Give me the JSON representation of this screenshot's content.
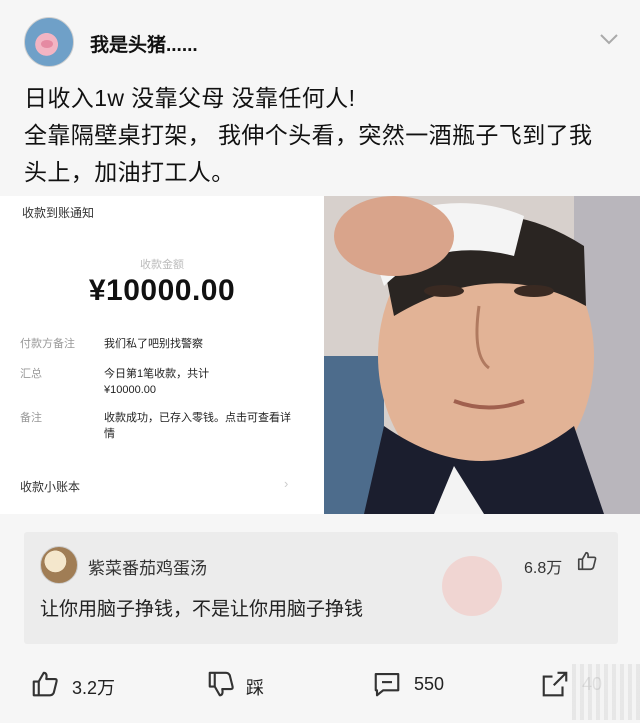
{
  "header": {
    "username": "我是头猪......"
  },
  "post": {
    "lines": [
      "日收入1w  没靠父母  没靠任何人!",
      "全靠隔壁桌打架，  我伸个头看，突然一酒瓶子飞到了我",
      "头上，加油打工人。"
    ]
  },
  "receipt": {
    "title": "收款到账通知",
    "amount_label": "收款金额",
    "amount": "¥10000.00",
    "rows": [
      {
        "key": "付款方备注",
        "value": "我们私了吧别找警察"
      },
      {
        "key": "汇总",
        "value": "今日第1笔收款，共计 ¥10000.00"
      },
      {
        "key": "备注",
        "value": "收款成功，已存入零钱。点击可查看详情"
      }
    ],
    "footer": "收款小账本",
    "footer_arrow": "›"
  },
  "comment": {
    "name": "紫菜番茄鸡蛋汤",
    "likes": "6.8万",
    "text": "让你用脑子挣钱，不是让你用脑子挣钱"
  },
  "actions": {
    "like_count": "3.2万",
    "dislike_label": "踩",
    "comment_count": "550",
    "share_count": "40"
  }
}
